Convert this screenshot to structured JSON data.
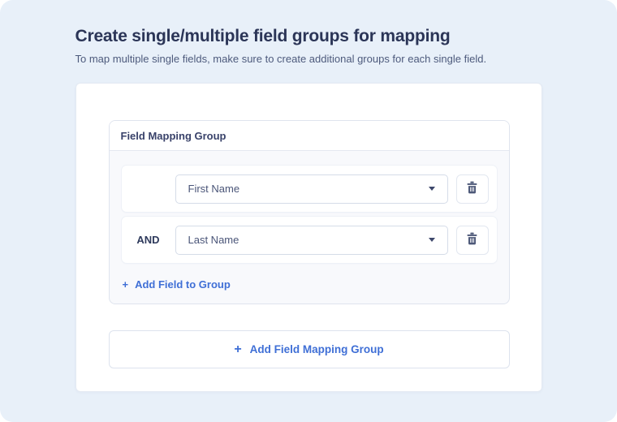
{
  "page": {
    "title": "Create single/multiple field groups for mapping",
    "subtitle": "To map multiple single fields, make sure to create additional groups for each single field."
  },
  "group": {
    "header_label": "Field Mapping Group",
    "rows": [
      {
        "operator": "",
        "field": "First Name"
      },
      {
        "operator": "AND",
        "field": "Last Name"
      }
    ],
    "add_field": {
      "plus": "+",
      "label": "Add Field to Group"
    }
  },
  "add_group_button": {
    "plus": "+",
    "label": "Add Field Mapping Group"
  },
  "icons": {
    "trash": "trash-icon",
    "caret": "chevron-down-icon"
  },
  "colors": {
    "page_background": "#e8f0f9",
    "accent_blue": "#3f6fd6",
    "heading_navy": "#2b3557",
    "icon_slate": "#4d5878"
  }
}
